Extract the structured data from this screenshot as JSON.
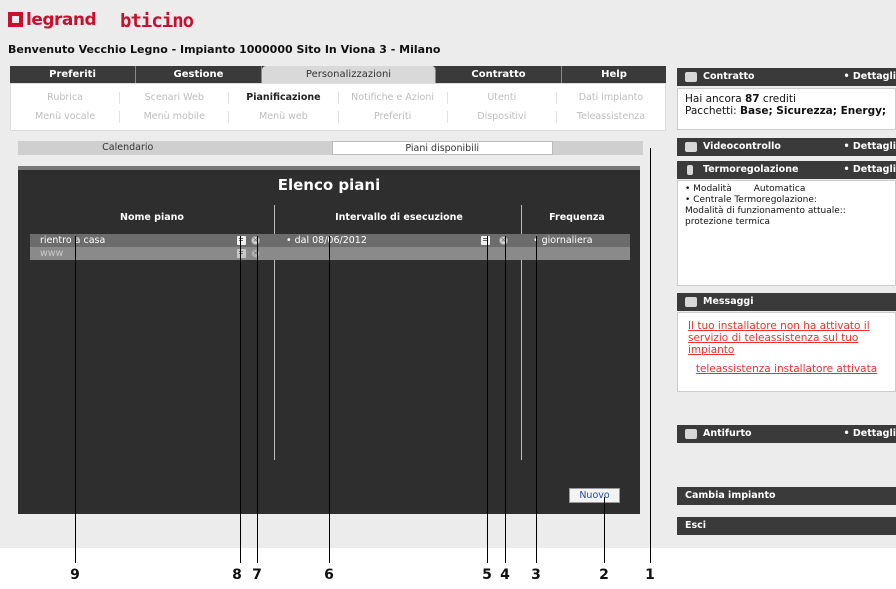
{
  "brand": {
    "logo1": "legrand",
    "logo2": "bticino"
  },
  "welcome": "Benvenuto Vecchio Legno - Impianto 1000000 Sito In Viona 3 - Milano",
  "main_tabs": [
    "Preferiti",
    "Gestione",
    "Personalizzazioni",
    "Contratto",
    "Help"
  ],
  "sub_menu": {
    "row1": [
      "Rubrica",
      "Scenari Web",
      "Pianificazione",
      "Notifiche e Azioni",
      "Utenti",
      "Dati impianto"
    ],
    "row2": [
      "Menù vocale",
      "Menù mobile",
      "Menù web",
      "Preferiti",
      "Dispositivi",
      "Teleassistenza"
    ]
  },
  "section_tabs": [
    "Calendario",
    "Piani disponibili"
  ],
  "plans": {
    "title": "Elenco piani",
    "columns": [
      "Nome piano",
      "Intervallo di esecuzione",
      "Frequenza"
    ],
    "rows": [
      {
        "name": "rientro a casa",
        "interval": "• dal 08/06/2012",
        "frequency": "• giornaliera"
      },
      {
        "name": "www",
        "interval": "",
        "frequency": ""
      }
    ],
    "new_button": "Nuovo"
  },
  "sidebar": {
    "details": "• Dettagli",
    "contratto": {
      "title": "Contratto",
      "credits_prefix": "Hai ancora ",
      "credits_value": "87",
      "credits_suffix": " crediti",
      "packages_prefix": "Pacchetti: ",
      "packages": "Base; Sicurezza; Energy;"
    },
    "videocontrollo": {
      "title": "Videocontrollo"
    },
    "termo": {
      "title": "Termoregolazione",
      "line1_label": "• Modalità",
      "line1_value": "Automatica",
      "line2": "• Centrale Termoregolazione:",
      "line3": "Modalità di funzionamento attuale::",
      "line4": "protezione termica"
    },
    "messaggi": {
      "title": "Messaggi",
      "msg1": "Il tuo installatore non ha attivato il servizio di teleassistenza sul tuo impianto",
      "msg2": "teleassistenza installatore attivata"
    },
    "antifurto": {
      "title": "Antifurto"
    },
    "cambia": "Cambia impianto",
    "esci": "Esci"
  },
  "callouts": [
    "9",
    "8",
    "7",
    "6",
    "5",
    "4",
    "3",
    "2",
    "1"
  ]
}
